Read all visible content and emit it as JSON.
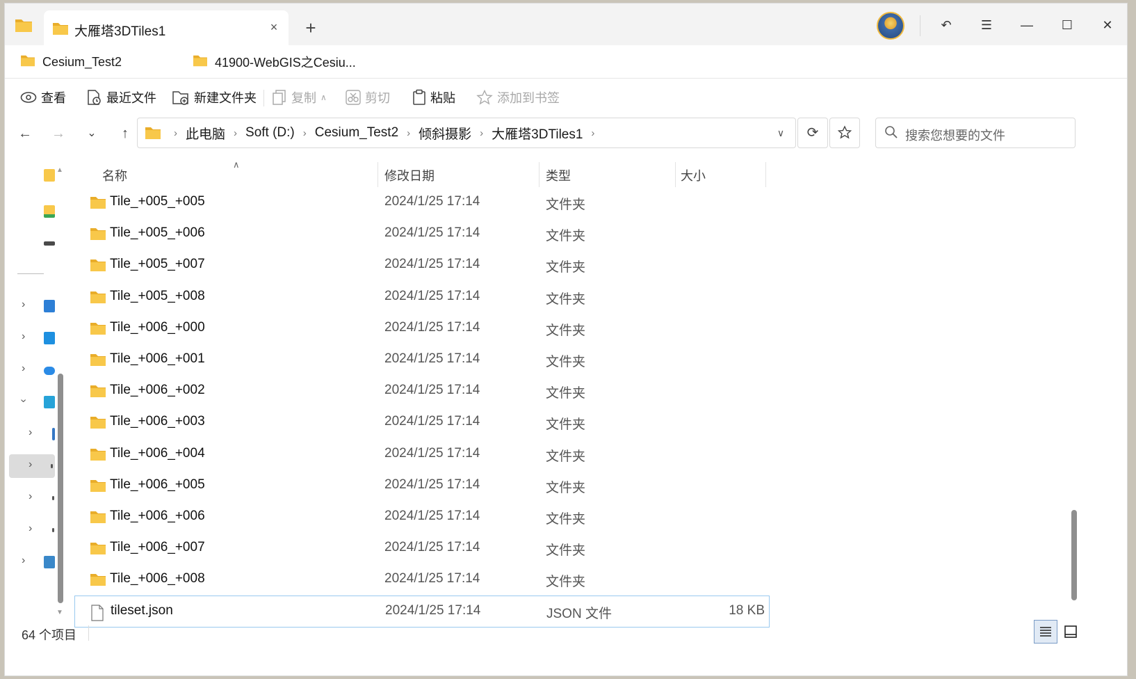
{
  "window": {
    "tab_title": "大雁塔3DTiles1",
    "close_tab": "×",
    "new_tab": "+"
  },
  "titlebar_buttons": {
    "undo": "↶",
    "menu": "☰",
    "minimize": "—",
    "maximize": "☐",
    "close": "✕"
  },
  "bookmarks": [
    {
      "label": "Cesium_Test2"
    },
    {
      "label": "41900-WebGIS之Cesiu..."
    }
  ],
  "toolbar": {
    "view": "查看",
    "recent": "最近文件",
    "new_folder": "新建文件夹",
    "copy": "复制",
    "cut": "剪切",
    "paste": "粘贴",
    "add_bookmark": "添加到书签"
  },
  "nav": {
    "back": "←",
    "forward": "→",
    "recent_locations": "⌄",
    "up": "↑"
  },
  "breadcrumb": [
    "此电脑",
    "Soft (D:)",
    "Cesium_Test2",
    "倾斜摄影",
    "大雁塔3DTiles1"
  ],
  "search": {
    "placeholder": "搜索您想要的文件"
  },
  "columns": {
    "name": "名称",
    "date": "修改日期",
    "type": "类型",
    "size": "大小"
  },
  "files": [
    {
      "name": "Tile_+005_+005",
      "date": "2024/1/25 17:14",
      "type": "文件夹",
      "size": "",
      "kind": "folder"
    },
    {
      "name": "Tile_+005_+006",
      "date": "2024/1/25 17:14",
      "type": "文件夹",
      "size": "",
      "kind": "folder"
    },
    {
      "name": "Tile_+005_+007",
      "date": "2024/1/25 17:14",
      "type": "文件夹",
      "size": "",
      "kind": "folder"
    },
    {
      "name": "Tile_+005_+008",
      "date": "2024/1/25 17:14",
      "type": "文件夹",
      "size": "",
      "kind": "folder"
    },
    {
      "name": "Tile_+006_+000",
      "date": "2024/1/25 17:14",
      "type": "文件夹",
      "size": "",
      "kind": "folder"
    },
    {
      "name": "Tile_+006_+001",
      "date": "2024/1/25 17:14",
      "type": "文件夹",
      "size": "",
      "kind": "folder"
    },
    {
      "name": "Tile_+006_+002",
      "date": "2024/1/25 17:14",
      "type": "文件夹",
      "size": "",
      "kind": "folder"
    },
    {
      "name": "Tile_+006_+003",
      "date": "2024/1/25 17:14",
      "type": "文件夹",
      "size": "",
      "kind": "folder"
    },
    {
      "name": "Tile_+006_+004",
      "date": "2024/1/25 17:14",
      "type": "文件夹",
      "size": "",
      "kind": "folder"
    },
    {
      "name": "Tile_+006_+005",
      "date": "2024/1/25 17:14",
      "type": "文件夹",
      "size": "",
      "kind": "folder"
    },
    {
      "name": "Tile_+006_+006",
      "date": "2024/1/25 17:14",
      "type": "文件夹",
      "size": "",
      "kind": "folder"
    },
    {
      "name": "Tile_+006_+007",
      "date": "2024/1/25 17:14",
      "type": "文件夹",
      "size": "",
      "kind": "folder"
    },
    {
      "name": "Tile_+006_+008",
      "date": "2024/1/25 17:14",
      "type": "文件夹",
      "size": "",
      "kind": "folder"
    },
    {
      "name": "tileset.json",
      "date": "2024/1/25 17:14",
      "type": "JSON 文件",
      "size": "18 KB",
      "kind": "file"
    }
  ],
  "status": {
    "count": "64 个项目"
  },
  "colors": {
    "folder": "#f8c84a",
    "folder_dark": "#e9ad2a",
    "selection_border": "#99c9ef",
    "accent": "#2b6cc4"
  }
}
